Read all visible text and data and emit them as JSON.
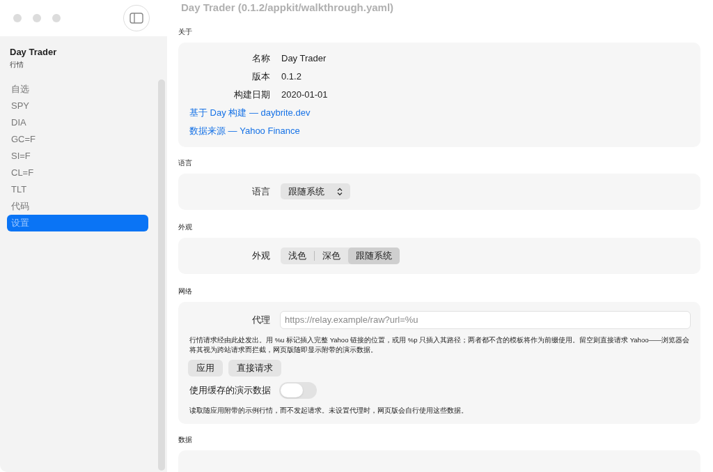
{
  "window": {
    "title": "Day Trader (0.1.2/appkit/walkthrough.yaml)"
  },
  "sidebar": {
    "app_name": "Day Trader",
    "subtitle": "行情",
    "items": [
      {
        "label": "自选",
        "selected": false
      },
      {
        "label": "SPY",
        "selected": false
      },
      {
        "label": "DIA",
        "selected": false
      },
      {
        "label": "GC=F",
        "selected": false
      },
      {
        "label": "SI=F",
        "selected": false
      },
      {
        "label": "CL=F",
        "selected": false
      },
      {
        "label": "TLT",
        "selected": false
      },
      {
        "label": "代码",
        "selected": false
      },
      {
        "label": "设置",
        "selected": true
      }
    ]
  },
  "about": {
    "heading": "关于",
    "rows": [
      {
        "label": "名称",
        "value": "Day Trader"
      },
      {
        "label": "版本",
        "value": "0.1.2"
      },
      {
        "label": "构建日期",
        "value": "2020-01-01"
      }
    ],
    "links": [
      "基于 Day 构建 — daybrite.dev",
      "数据来源 — Yahoo Finance"
    ]
  },
  "language": {
    "heading": "语言",
    "label": "语言",
    "value": "跟随系统"
  },
  "appearance": {
    "heading": "外观",
    "label": "外观",
    "options": [
      {
        "label": "浅色",
        "selected": false
      },
      {
        "label": "深色",
        "selected": false
      },
      {
        "label": "跟随系统",
        "selected": true
      }
    ]
  },
  "network": {
    "heading": "网络",
    "proxy_label": "代理",
    "proxy_placeholder": "https://relay.example/raw?url=%u",
    "help": "行情请求经由此处发出。用 %u 标记插入完整 Yahoo 链接的位置，或用 %p 只插入其路径；两者都不含的模板将作为前缀使用。留空则直接请求 Yahoo——浏览器会将其视为跨站请求而拦截，网页版随即显示附带的演示数据。",
    "buttons": [
      "应用",
      "直接请求"
    ],
    "cached_label": "使用缓存的演示数据",
    "cached_on": false,
    "cached_help": "读取随应用附带的示例行情，而不发起请求。未设置代理时，网页版会自行使用这些数据。"
  },
  "data": {
    "heading": "数据"
  }
}
